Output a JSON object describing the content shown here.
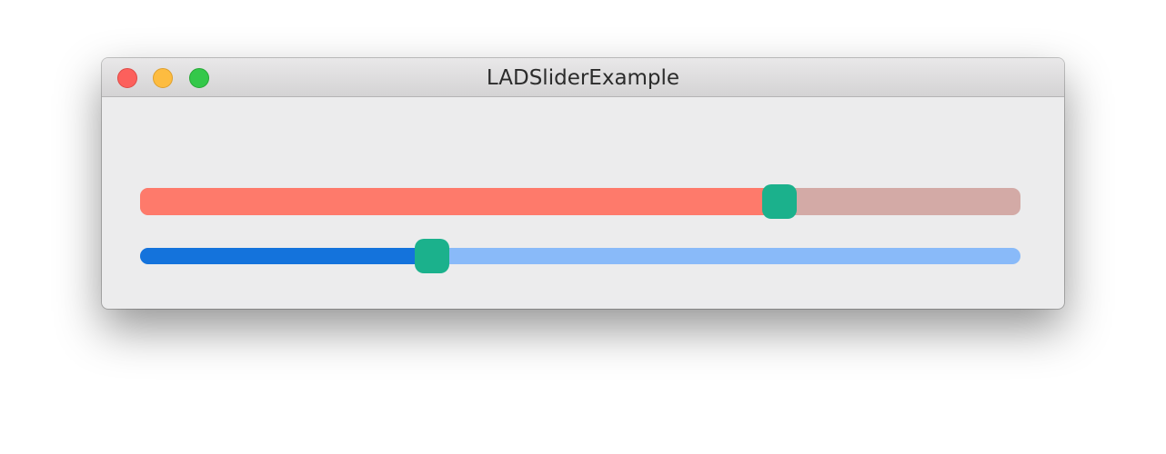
{
  "window": {
    "title": "LADSliderExample"
  },
  "sliders": [
    {
      "value": 0.726,
      "track_color": "#d3aaa6",
      "fill_color": "#fe7a6b",
      "thumb_color": "#1bb18c"
    },
    {
      "value": 0.332,
      "track_color": "#89baf9",
      "fill_color": "#1473dc",
      "thumb_color": "#1bb18c"
    }
  ]
}
